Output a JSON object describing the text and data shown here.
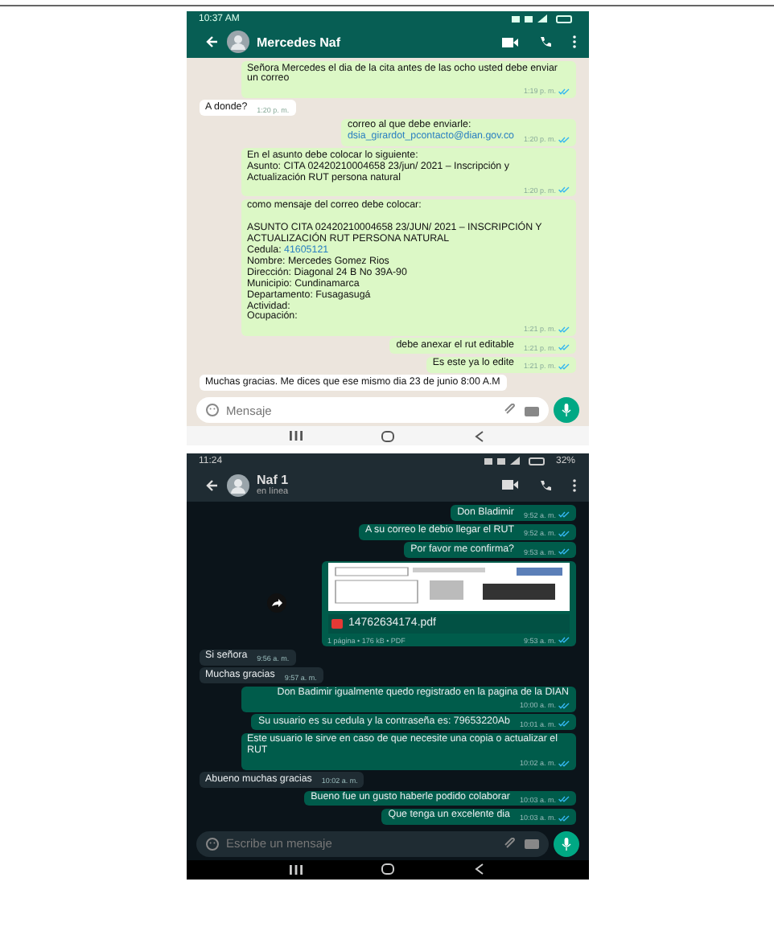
{
  "screenshots": [
    {
      "dark": false,
      "status_time": "10:37 AM",
      "contact": "Mercedes Naf",
      "placeholder": "Mensaje",
      "messages": [
        {
          "kind": "text",
          "outgoing": true,
          "parts": [
            {
              "kind": "plain",
              "text": "Señora Mercedes el dia de la cita antes de las ocho usted debe enviar un correo"
            }
          ],
          "time": "1:19 p. m.",
          "read": true
        },
        {
          "kind": "text",
          "outgoing": false,
          "parts": [
            {
              "kind": "plain",
              "text": "A donde?"
            }
          ],
          "time": "1:20 p. m."
        },
        {
          "kind": "text",
          "outgoing": true,
          "parts": [
            {
              "kind": "plain",
              "text": "correo al que debe enviarle:\n"
            },
            {
              "kind": "link",
              "text": "dsia_girardot_pcontacto@dian.gov.co"
            }
          ],
          "time": "1:20 p. m.",
          "read": true
        },
        {
          "kind": "text",
          "outgoing": true,
          "parts": [
            {
              "kind": "plain",
              "text": "En el asunto debe colocar lo siguiente:\nAsunto: CITA 02420210004658 23/jun/ 2021 – Inscripción y Actualización RUT persona natural"
            }
          ],
          "time": "1:20 p. m.",
          "read": true
        },
        {
          "kind": "text",
          "outgoing": true,
          "parts": [
            {
              "kind": "plain",
              "text": "como mensaje del correo debe colocar:\n\nASUNTO CITA 02420210004658 23/JUN/ 2021 – INSCRIPCIÓN Y ACTUALIZACIÓN RUT PERSONA NATURAL\nCedula: "
            },
            {
              "kind": "link",
              "text": "41605121"
            },
            {
              "kind": "plain",
              "text": "\nNombre: Mercedes Gomez Rios\nDirección: Diagonal 24 B No 39A-90\nMunicipio: Cundinamarca\nDepartamento: Fusagasugá\nActividad:\nOcupación:"
            }
          ],
          "time": "1:21 p. m.",
          "read": true
        },
        {
          "kind": "text",
          "outgoing": true,
          "parts": [
            {
              "kind": "plain",
              "text": "debe anexar el rut editable"
            }
          ],
          "time": "1:21 p. m.",
          "read": true
        },
        {
          "kind": "text",
          "outgoing": true,
          "parts": [
            {
              "kind": "plain",
              "text": "Es este ya lo edite"
            }
          ],
          "time": "1:21 p. m.",
          "read": true
        },
        {
          "kind": "text",
          "outgoing": false,
          "parts": [
            {
              "kind": "plain",
              "text": "Muchas gracias. Me dices que ese mismo dia 23 de junio 8:00 A.M"
            }
          ]
        }
      ]
    },
    {
      "dark": true,
      "status_time": "11:24",
      "battery": "32%",
      "contact": "Naf 1",
      "subtitle": "en línea",
      "placeholder": "Escribe un mensaje",
      "messages": [
        {
          "kind": "text",
          "outgoing": true,
          "parts": [
            {
              "kind": "plain",
              "text": "Don Bladimir"
            }
          ],
          "time": "9:52 a. m.",
          "read": true
        },
        {
          "kind": "text",
          "outgoing": true,
          "parts": [
            {
              "kind": "plain",
              "text": "A su correo le debio llegar el  RUT"
            }
          ],
          "time": "9:52 a. m.",
          "read": true
        },
        {
          "kind": "text",
          "outgoing": true,
          "parts": [
            {
              "kind": "plain",
              "text": "Por favor me confirma?"
            }
          ],
          "time": "9:53 a. m.",
          "read": true
        },
        {
          "kind": "document",
          "outgoing": true,
          "file": "14762634174.pdf",
          "meta": "1 página • 176 kB • PDF",
          "time": "9:53 a. m.",
          "read": true
        },
        {
          "kind": "text",
          "outgoing": false,
          "parts": [
            {
              "kind": "plain",
              "text": "Si señora"
            }
          ],
          "time": "9:56 a. m."
        },
        {
          "kind": "text",
          "outgoing": false,
          "parts": [
            {
              "kind": "plain",
              "text": "Muchas gracias"
            }
          ],
          "time": "9:57 a. m."
        },
        {
          "kind": "text",
          "outgoing": true,
          "parts": [
            {
              "kind": "plain",
              "text": "Don Badimir igualmente quedo registrado en la pagina de la DIAN"
            }
          ],
          "time": "10:00 a. m.",
          "read": true
        },
        {
          "kind": "text",
          "outgoing": true,
          "parts": [
            {
              "kind": "plain",
              "text": "Su usuario es su cedula y la contraseña es: 79653220Ab"
            }
          ],
          "time": "10:01 a. m.",
          "read": true
        },
        {
          "kind": "text",
          "outgoing": true,
          "parts": [
            {
              "kind": "plain",
              "text": "Este usuario le sirve en caso de que necesite una copia o actualizar el RUT"
            }
          ],
          "time": "10:02 a. m.",
          "read": true
        },
        {
          "kind": "text",
          "outgoing": false,
          "parts": [
            {
              "kind": "plain",
              "text": "Abueno muchas gracias"
            }
          ],
          "time": "10:02 a. m."
        },
        {
          "kind": "text",
          "outgoing": true,
          "parts": [
            {
              "kind": "plain",
              "text": "Bueno fue un gusto haberle podido colaborar"
            }
          ],
          "time": "10:03 a. m.",
          "read": true
        },
        {
          "kind": "text",
          "outgoing": true,
          "parts": [
            {
              "kind": "plain",
              "text": "Que tenga un excelente dia"
            }
          ],
          "time": "10:03 a. m.",
          "read": true
        }
      ]
    }
  ]
}
